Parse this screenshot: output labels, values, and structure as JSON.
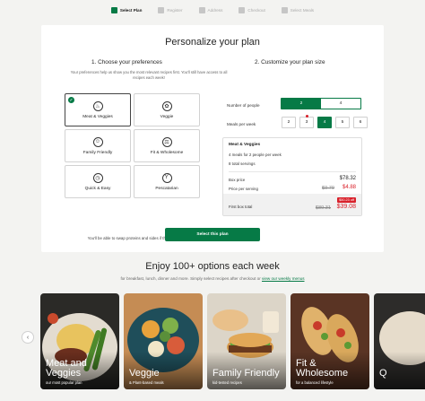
{
  "steps": [
    {
      "label": "Select Plan",
      "icon": "plan-icon",
      "active": true
    },
    {
      "label": "Register",
      "icon": "user-icon",
      "active": false
    },
    {
      "label": "Address",
      "icon": "pin-icon",
      "active": false
    },
    {
      "label": "Checkout",
      "icon": "card-icon",
      "active": false
    },
    {
      "label": "Select Meals",
      "icon": "utensils-icon",
      "active": false
    }
  ],
  "main_title": "Personalize your plan",
  "left": {
    "title": "1. Choose your preferences",
    "intro": "Your preferences help us show you the most relevant recipes first. You'll still have access to all recipes each week!",
    "options": [
      {
        "label": "Meat & Veggies",
        "icon": "meat-icon",
        "selected": true
      },
      {
        "label": "Veggie",
        "icon": "carrot-icon",
        "selected": false
      },
      {
        "label": "Family Friendly",
        "icon": "family-icon",
        "selected": false
      },
      {
        "label": "Fit & Wholesome",
        "icon": "scale-icon",
        "selected": false
      },
      {
        "label": "Quick & Easy",
        "icon": "stopwatch-icon",
        "selected": false
      },
      {
        "label": "Pescatarian",
        "icon": "fish-icon",
        "selected": false
      }
    ],
    "swap_note": "You'll be able to swap proteins and sides if they aren't a perfect match."
  },
  "right": {
    "title": "2. Customize your plan size",
    "people_label": "Number of people",
    "people_options": [
      "2",
      "4"
    ],
    "people_selected": "2",
    "meals_label": "Meals per week",
    "meals_options": [
      "2",
      "3",
      "4",
      "5",
      "6"
    ],
    "meals_selected": "4",
    "summary": {
      "title": "Meat & Veggies",
      "line1": "4 meals for 2 people per week",
      "line2": "8 total servings",
      "box_price_label": "Box price",
      "box_price": "$78.32",
      "per_serving_label": "Price per serving",
      "per_serving_old": "$9.79",
      "per_serving_new": "$4.88",
      "first_box_label": "First box total",
      "first_box_old": "$89.31",
      "first_box_new": "$39.08",
      "save_badge": "$50.23 off"
    }
  },
  "select_button": "Select this plan",
  "enjoy_title": "Enjoy 100+ options each week",
  "enjoy_sub": "for breakfast, lunch, dinner and more. Simply select recipes after checkout or",
  "enjoy_link": "view our weekly menus",
  "tiles": [
    {
      "name": "Meat and Veggies",
      "sub": "our most popular plan"
    },
    {
      "name": "Veggie",
      "sub": "& Plant-based meals"
    },
    {
      "name": "Family Friendly",
      "sub": "kid-tested recipes"
    },
    {
      "name": "Fit & Wholesome",
      "sub": "for a balanced lifestyle"
    },
    {
      "name": "Q",
      "sub": ""
    }
  ],
  "colors": {
    "accent": "#067a46",
    "sale": "#d9202a"
  }
}
